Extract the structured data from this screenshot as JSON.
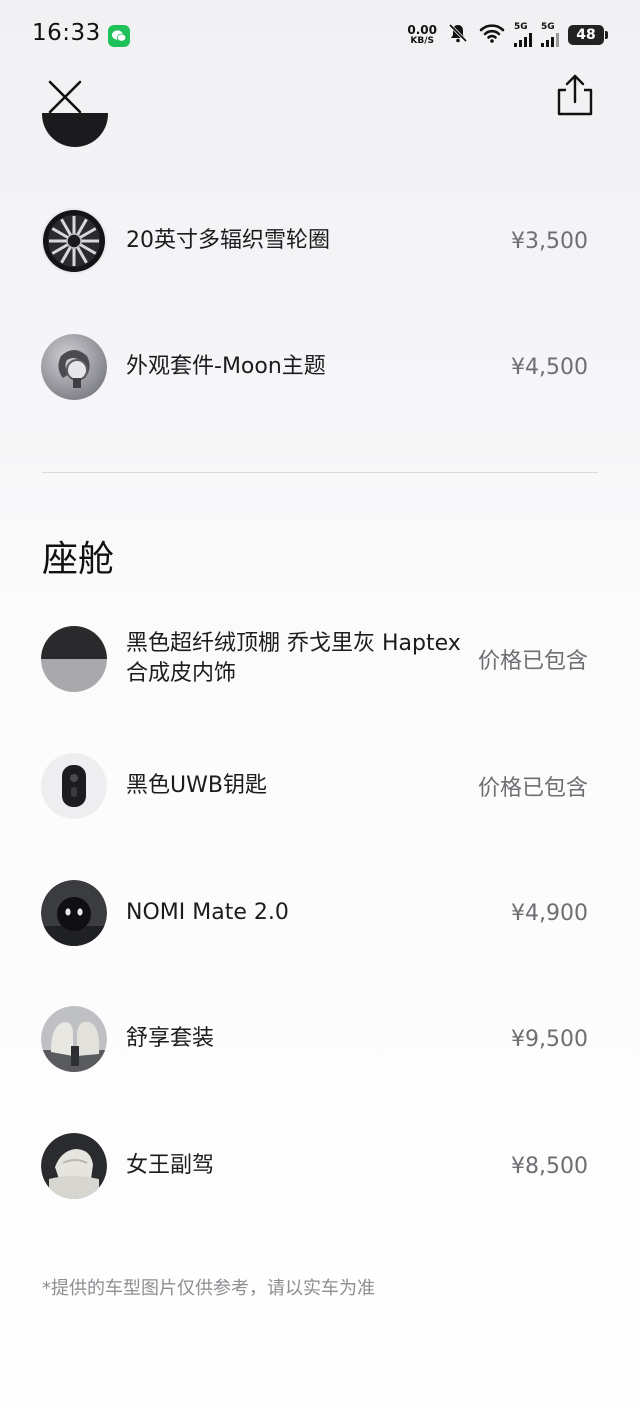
{
  "status_bar": {
    "time": "16:33",
    "net_speed_value": "0.00",
    "net_speed_unit": "KB/S",
    "signal1_label": "5G",
    "signal2_label": "5G",
    "battery_level": "48",
    "icons": [
      "wechat-icon",
      "mute-bell-icon",
      "wifi-icon",
      "signal-icon",
      "battery-icon"
    ]
  },
  "header": {
    "icons": [
      "close-icon",
      "share-icon"
    ]
  },
  "exterior_items": [
    {
      "name": "20英寸多辐织雪轮圈",
      "price": "¥3,500",
      "icon": "wheel-rim-thumbnail"
    },
    {
      "name": "外观套件-Moon主题",
      "price": "¥4,500",
      "icon": "exterior-kit-thumbnail"
    }
  ],
  "cabin": {
    "title": "座舱",
    "items": [
      {
        "name": "黑色超纤绒顶棚 乔戈里灰 Haptex合成皮内饰",
        "price": "价格已包含",
        "icon": "interior-color-thumbnail"
      },
      {
        "name": "黑色UWB钥匙",
        "price": "价格已包含",
        "icon": "uwb-key-thumbnail"
      },
      {
        "name": "NOMI Mate 2.0",
        "price": "¥4,900",
        "icon": "nomi-mate-thumbnail"
      },
      {
        "name": "舒享套装",
        "price": "¥9,500",
        "icon": "comfort-package-thumbnail"
      },
      {
        "name": "女王副驾",
        "price": "¥8,500",
        "icon": "queen-seat-thumbnail"
      }
    ]
  },
  "disclaimer": "*提供的车型图片仅供参考，请以实车为准",
  "colors": {
    "text_primary": "#1c1c1e",
    "text_secondary": "#6e6e73",
    "disclaimer": "#8e8e93",
    "divider": "#dcdcdf",
    "wechat_green": "#1fc15a"
  }
}
